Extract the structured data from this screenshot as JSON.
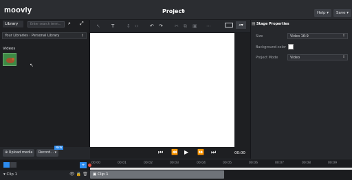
{
  "header": {
    "logo": "moovly",
    "project_title": "Project",
    "help_label": "Help ▾",
    "save_label": "Save ▾"
  },
  "library": {
    "tab_label": "Library",
    "search_placeholder": "Enter search term...",
    "breadcrumb_root": "Your Libraries",
    "breadcrumb_sep": "›",
    "breadcrumb_current": "Personal Library",
    "videos_label": "Videos",
    "upload_label": "Upload media",
    "record_label": "Record... ▾",
    "new_badge": "NEW"
  },
  "properties": {
    "title": "Stage Properties",
    "size_label": "Size",
    "size_value": "Video 16:9",
    "bg_label": "Background-color",
    "project_mode_label": "Project Mode",
    "project_mode_value": "Video"
  },
  "player": {
    "timecode": "00:00"
  },
  "timeline": {
    "ticks": [
      "00:00",
      "00:01",
      "00:02",
      "00:03",
      "00:04",
      "00:05",
      "00:06",
      "00:07",
      "00:08",
      "00:09"
    ],
    "track_label": "Clip 1",
    "clip_label": "Clip 1"
  },
  "icons": {
    "search": "search-icon",
    "expand": "expand-icon",
    "edit": "pencil-icon",
    "undo": "undo-icon",
    "redo": "redo-icon",
    "play": "play-icon"
  },
  "colors": {
    "accent": "#2d8cf0",
    "stage": "#ffffff",
    "playhead": "#e74c3c",
    "clip": "#6f7379"
  }
}
